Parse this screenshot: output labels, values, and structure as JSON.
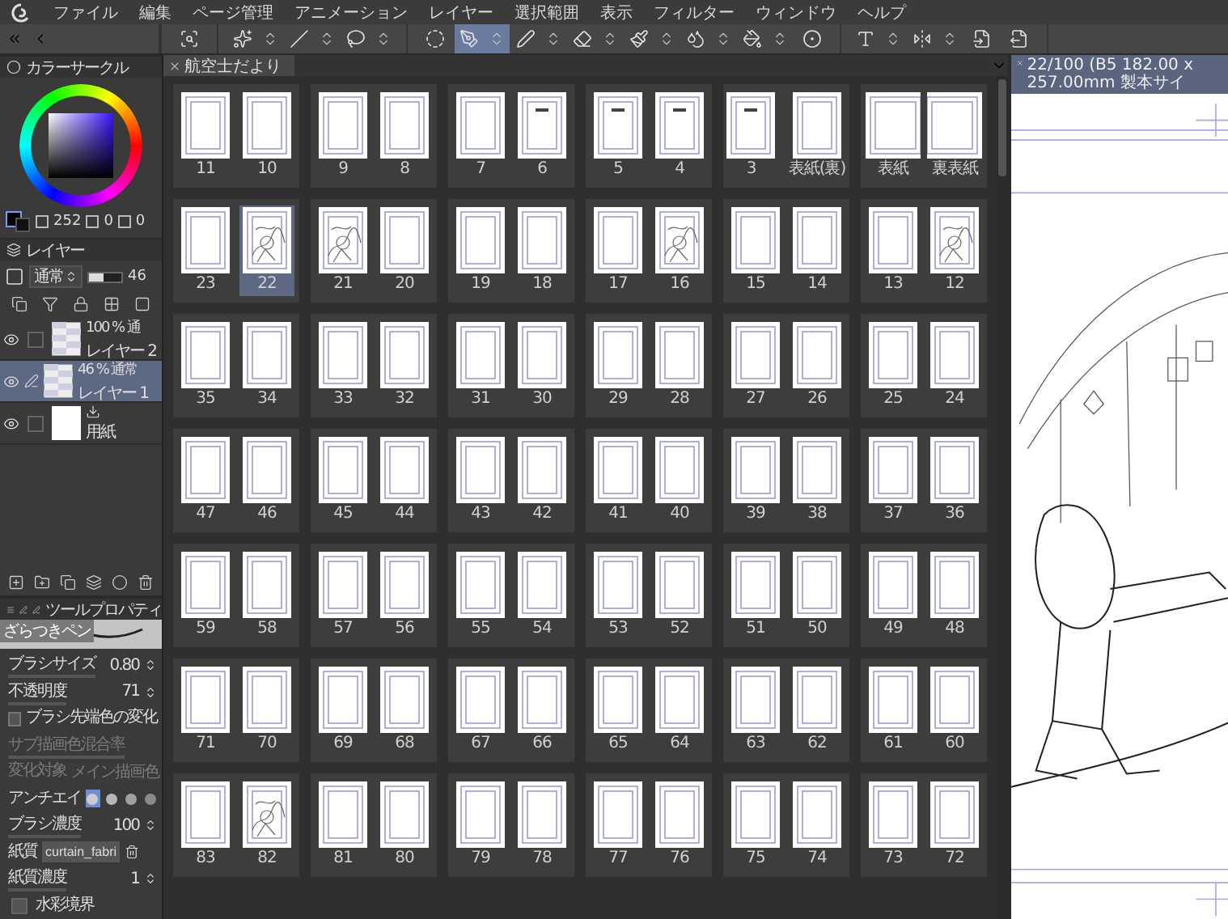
{
  "menu": [
    "ファイル",
    "編集",
    "ページ管理",
    "アニメーション",
    "レイヤー",
    "選択範囲",
    "表示",
    "フィルター",
    "ウィンドウ",
    "ヘルプ"
  ],
  "tool_groups": [
    [
      {
        "kind": "navigator",
        "selected": false,
        "has_menu": false
      }
    ],
    [
      {
        "kind": "wand",
        "selected": false,
        "has_menu": true
      },
      {
        "kind": "line",
        "selected": false,
        "has_menu": true
      },
      {
        "kind": "lasso",
        "selected": false,
        "has_menu": true
      }
    ],
    [
      {
        "kind": "selection",
        "selected": false,
        "has_menu": false
      },
      {
        "kind": "pen",
        "selected": true,
        "has_menu": true
      },
      {
        "kind": "marker",
        "selected": false,
        "has_menu": true
      },
      {
        "kind": "eraser",
        "selected": false,
        "has_menu": true
      },
      {
        "kind": "brush",
        "selected": false,
        "has_menu": true
      },
      {
        "kind": "blend",
        "selected": false,
        "has_menu": true
      },
      {
        "kind": "fill",
        "selected": false,
        "has_menu": true
      },
      {
        "kind": "gradient",
        "selected": false,
        "has_menu": false
      }
    ],
    [
      {
        "kind": "text",
        "selected": false,
        "has_menu": true
      },
      {
        "kind": "mirror",
        "selected": false,
        "has_menu": true
      },
      {
        "kind": "page_prev",
        "selected": false,
        "has_menu": false
      },
      {
        "kind": "page_next",
        "selected": false,
        "has_menu": false
      }
    ]
  ],
  "color_panel": {
    "title": "カラーサークル",
    "values": [
      "252",
      "0",
      "0"
    ]
  },
  "layer_panel": {
    "title": "レイヤー",
    "blend_mode": "通常",
    "opacity_slider": {
      "level": 0.46
    },
    "opacity": "46",
    "layers": [
      {
        "kind": "raster",
        "info": "100 % 通",
        "name": "レイヤー 2",
        "selected": false
      },
      {
        "kind": "raster",
        "info": "46 % 通常",
        "name": "レイヤー 1",
        "selected": true
      },
      {
        "kind": "paper",
        "name": "用紙",
        "selected": false
      }
    ]
  },
  "tool_property": {
    "title": "ツールプロパティ",
    "brush_name": "ざらつきペン",
    "rows": [
      {
        "kind": "value",
        "label": "ブラシサイズ",
        "value": "0.80",
        "disabled": false
      },
      {
        "kind": "value",
        "label": "不透明度",
        "value": "71",
        "disabled": false
      },
      {
        "kind": "toggle",
        "label": "ブラシ先端色の変化",
        "on": false,
        "disabled": false
      },
      {
        "kind": "value",
        "label": "サブ描画色混合率",
        "disabled": true
      },
      {
        "kind": "select",
        "label": "変化対象",
        "value": "メイン描画色",
        "disabled": true
      },
      {
        "kind": "antialias",
        "label": "アンチエイ",
        "options": [
          {
            "selected": true
          },
          {
            "selected": false
          },
          {
            "selected": false
          },
          {
            "selected": false
          }
        ],
        "disabled": false
      },
      {
        "kind": "value",
        "label": "ブラシ濃度",
        "value": "100",
        "disabled": false
      },
      {
        "kind": "texture",
        "label": "紙質",
        "value": "curtain_fabri",
        "disabled": false
      },
      {
        "kind": "value",
        "label": "紙質濃度",
        "value": "1",
        "disabled": false
      },
      {
        "kind": "check",
        "label": "水彩境界",
        "checked": false,
        "disabled": false
      }
    ]
  },
  "page_manager": {
    "tab": "航空士だより",
    "spreads": [
      {
        "kind": "pair",
        "pages": [
          {
            "label": "11",
            "kind": "blank",
            "selected": false
          },
          {
            "label": "10",
            "kind": "blank",
            "selected": false
          }
        ]
      },
      {
        "kind": "pair",
        "pages": [
          {
            "label": "9",
            "kind": "blank",
            "selected": false
          },
          {
            "label": "8",
            "kind": "blank",
            "selected": false
          }
        ]
      },
      {
        "kind": "pair",
        "pages": [
          {
            "label": "7",
            "kind": "blank",
            "selected": false
          },
          {
            "label": "6",
            "kind": "title",
            "selected": false
          }
        ]
      },
      {
        "kind": "pair",
        "pages": [
          {
            "label": "5",
            "kind": "title",
            "selected": false
          },
          {
            "label": "4",
            "kind": "title",
            "selected": false
          }
        ]
      },
      {
        "kind": "pair",
        "pages": [
          {
            "label": "3",
            "kind": "title",
            "selected": false
          },
          {
            "label": "表紙(裏)",
            "kind": "blank",
            "selected": false
          }
        ]
      },
      {
        "kind": "joined",
        "pages": [
          {
            "label": "表紙",
            "kind": "blank",
            "selected": false
          },
          {
            "label": "裏表紙",
            "kind": "blank",
            "selected": false
          }
        ]
      },
      {
        "kind": "pair",
        "pages": [
          {
            "label": "23",
            "kind": "blank",
            "selected": false
          },
          {
            "label": "22",
            "kind": "sketch",
            "selected": true
          }
        ]
      },
      {
        "kind": "pair",
        "pages": [
          {
            "label": "21",
            "kind": "sketch",
            "selected": false
          },
          {
            "label": "20",
            "kind": "blank",
            "selected": false
          }
        ]
      },
      {
        "kind": "pair",
        "pages": [
          {
            "label": "19",
            "kind": "blank",
            "selected": false
          },
          {
            "label": "18",
            "kind": "blank",
            "selected": false
          }
        ]
      },
      {
        "kind": "pair",
        "pages": [
          {
            "label": "17",
            "kind": "blank",
            "selected": false
          },
          {
            "label": "16",
            "kind": "sketch",
            "selected": false
          }
        ]
      },
      {
        "kind": "pair",
        "pages": [
          {
            "label": "15",
            "kind": "blank",
            "selected": false
          },
          {
            "label": "14",
            "kind": "blank",
            "selected": false
          }
        ]
      },
      {
        "kind": "pair",
        "pages": [
          {
            "label": "13",
            "kind": "blank",
            "selected": false
          },
          {
            "label": "12",
            "kind": "sketch",
            "selected": false
          }
        ]
      },
      {
        "kind": "pair",
        "pages": [
          {
            "label": "35",
            "kind": "blank",
            "selected": false
          },
          {
            "label": "34",
            "kind": "blank",
            "selected": false
          }
        ]
      },
      {
        "kind": "pair",
        "pages": [
          {
            "label": "33",
            "kind": "blank",
            "selected": false
          },
          {
            "label": "32",
            "kind": "blank",
            "selected": false
          }
        ]
      },
      {
        "kind": "pair",
        "pages": [
          {
            "label": "31",
            "kind": "blank",
            "selected": false
          },
          {
            "label": "30",
            "kind": "blank",
            "selected": false
          }
        ]
      },
      {
        "kind": "pair",
        "pages": [
          {
            "label": "29",
            "kind": "blank",
            "selected": false
          },
          {
            "label": "28",
            "kind": "blank",
            "selected": false
          }
        ]
      },
      {
        "kind": "pair",
        "pages": [
          {
            "label": "27",
            "kind": "blank",
            "selected": false
          },
          {
            "label": "26",
            "kind": "blank",
            "selected": false
          }
        ]
      },
      {
        "kind": "pair",
        "pages": [
          {
            "label": "25",
            "kind": "blank",
            "selected": false
          },
          {
            "label": "24",
            "kind": "blank",
            "selected": false
          }
        ]
      },
      {
        "kind": "pair",
        "pages": [
          {
            "label": "47",
            "kind": "blank",
            "selected": false
          },
          {
            "label": "46",
            "kind": "blank",
            "selected": false
          }
        ]
      },
      {
        "kind": "pair",
        "pages": [
          {
            "label": "45",
            "kind": "blank",
            "selected": false
          },
          {
            "label": "44",
            "kind": "blank",
            "selected": false
          }
        ]
      },
      {
        "kind": "pair",
        "pages": [
          {
            "label": "43",
            "kind": "blank",
            "selected": false
          },
          {
            "label": "42",
            "kind": "blank",
            "selected": false
          }
        ]
      },
      {
        "kind": "pair",
        "pages": [
          {
            "label": "41",
            "kind": "blank",
            "selected": false
          },
          {
            "label": "40",
            "kind": "blank",
            "selected": false
          }
        ]
      },
      {
        "kind": "pair",
        "pages": [
          {
            "label": "39",
            "kind": "blank",
            "selected": false
          },
          {
            "label": "38",
            "kind": "blank",
            "selected": false
          }
        ]
      },
      {
        "kind": "pair",
        "pages": [
          {
            "label": "37",
            "kind": "blank",
            "selected": false
          },
          {
            "label": "36",
            "kind": "blank",
            "selected": false
          }
        ]
      },
      {
        "kind": "pair",
        "pages": [
          {
            "label": "59",
            "kind": "blank",
            "selected": false
          },
          {
            "label": "58",
            "kind": "blank",
            "selected": false
          }
        ]
      },
      {
        "kind": "pair",
        "pages": [
          {
            "label": "57",
            "kind": "blank",
            "selected": false
          },
          {
            "label": "56",
            "kind": "blank",
            "selected": false
          }
        ]
      },
      {
        "kind": "pair",
        "pages": [
          {
            "label": "55",
            "kind": "blank",
            "selected": false
          },
          {
            "label": "54",
            "kind": "blank",
            "selected": false
          }
        ]
      },
      {
        "kind": "pair",
        "pages": [
          {
            "label": "53",
            "kind": "blank",
            "selected": false
          },
          {
            "label": "52",
            "kind": "blank",
            "selected": false
          }
        ]
      },
      {
        "kind": "pair",
        "pages": [
          {
            "label": "51",
            "kind": "blank",
            "selected": false
          },
          {
            "label": "50",
            "kind": "blank",
            "selected": false
          }
        ]
      },
      {
        "kind": "pair",
        "pages": [
          {
            "label": "49",
            "kind": "blank",
            "selected": false
          },
          {
            "label": "48",
            "kind": "blank",
            "selected": false
          }
        ]
      },
      {
        "kind": "pair",
        "pages": [
          {
            "label": "71",
            "kind": "blank",
            "selected": false
          },
          {
            "label": "70",
            "kind": "blank",
            "selected": false
          }
        ]
      },
      {
        "kind": "pair",
        "pages": [
          {
            "label": "69",
            "kind": "blank",
            "selected": false
          },
          {
            "label": "68",
            "kind": "blank",
            "selected": false
          }
        ]
      },
      {
        "kind": "pair",
        "pages": [
          {
            "label": "67",
            "kind": "blank",
            "selected": false
          },
          {
            "label": "66",
            "kind": "blank",
            "selected": false
          }
        ]
      },
      {
        "kind": "pair",
        "pages": [
          {
            "label": "65",
            "kind": "blank",
            "selected": false
          },
          {
            "label": "64",
            "kind": "blank",
            "selected": false
          }
        ]
      },
      {
        "kind": "pair",
        "pages": [
          {
            "label": "63",
            "kind": "blank",
            "selected": false
          },
          {
            "label": "62",
            "kind": "blank",
            "selected": false
          }
        ]
      },
      {
        "kind": "pair",
        "pages": [
          {
            "label": "61",
            "kind": "blank",
            "selected": false
          },
          {
            "label": "60",
            "kind": "blank",
            "selected": false
          }
        ]
      },
      {
        "kind": "pair",
        "pages": [
          {
            "label": "83",
            "kind": "blank",
            "selected": false
          },
          {
            "label": "82",
            "kind": "sketch",
            "selected": false
          }
        ]
      },
      {
        "kind": "pair",
        "pages": [
          {
            "label": "81",
            "kind": "blank",
            "selected": false
          },
          {
            "label": "80",
            "kind": "blank",
            "selected": false
          }
        ]
      },
      {
        "kind": "pair",
        "pages": [
          {
            "label": "79",
            "kind": "blank",
            "selected": false
          },
          {
            "label": "78",
            "kind": "blank",
            "selected": false
          }
        ]
      },
      {
        "kind": "pair",
        "pages": [
          {
            "label": "77",
            "kind": "blank",
            "selected": false
          },
          {
            "label": "76",
            "kind": "blank",
            "selected": false
          }
        ]
      },
      {
        "kind": "pair",
        "pages": [
          {
            "label": "75",
            "kind": "blank",
            "selected": false
          },
          {
            "label": "74",
            "kind": "blank",
            "selected": false
          }
        ]
      },
      {
        "kind": "pair",
        "pages": [
          {
            "label": "73",
            "kind": "blank",
            "selected": false
          },
          {
            "label": "72",
            "kind": "blank",
            "selected": false
          }
        ]
      }
    ]
  },
  "canvas": {
    "tab": "22/100 (B5 182.00 x 257.00mm 製本サイ"
  }
}
